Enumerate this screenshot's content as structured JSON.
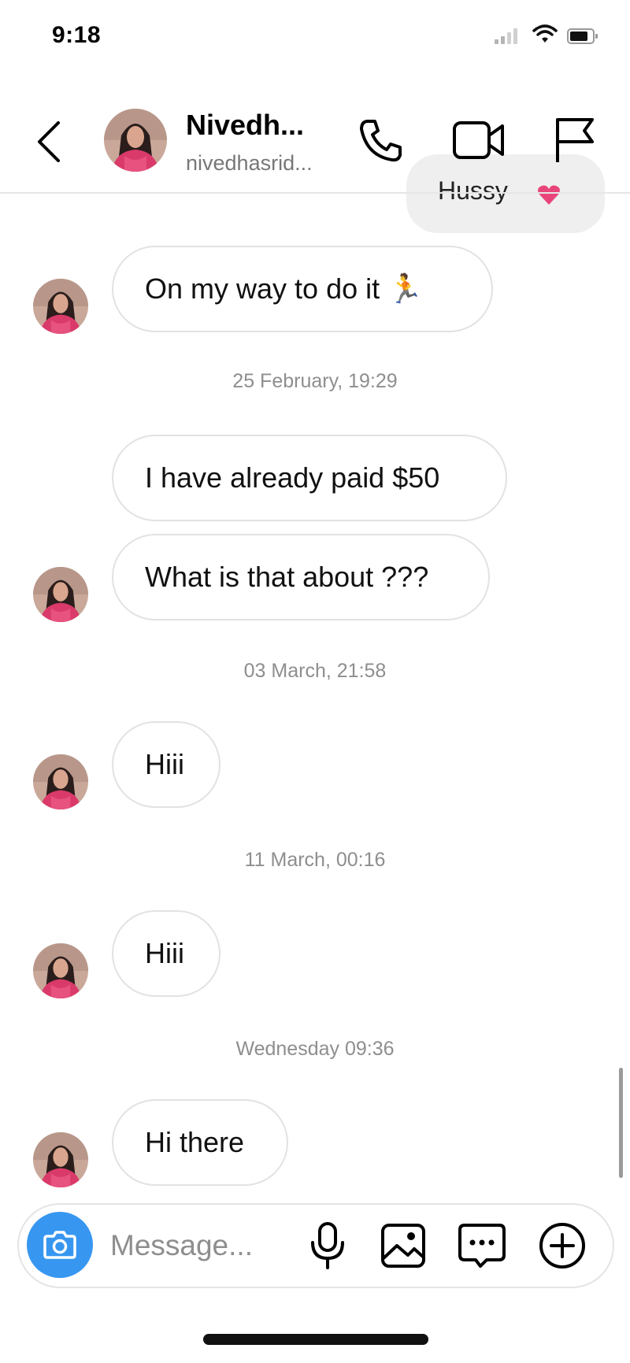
{
  "status_bar": {
    "time": "9:18"
  },
  "header": {
    "name": "Nivedh...",
    "username": "nivedhasrid...",
    "icons": [
      "back-chevron-icon",
      "phone-icon",
      "video-camera-icon",
      "flag-icon"
    ]
  },
  "conversation": {
    "partial_sent_message": {
      "text": "Hussy",
      "emoji": "heart-emoji"
    },
    "msg1": "On my way to do it 🏃",
    "ts1": "25 February, 19:29",
    "msg2": "I have already paid $50",
    "msg3": "What is that about ???",
    "ts2": "03 March, 21:58",
    "msg4": "Hiii",
    "ts3": "11 March, 00:16",
    "msg5": "Hiii",
    "ts4": "Wednesday 09:36",
    "msg6": "Hi there"
  },
  "composer": {
    "placeholder": "Message...",
    "icons": [
      "camera-icon",
      "microphone-icon",
      "gallery-icon",
      "sticker-chat-icon",
      "plus-icon"
    ]
  },
  "colors": {
    "accent": "#3797f0",
    "bubble_border": "#e2e2e2",
    "sent_bubble": "#efefef",
    "timestamp": "#8e8e8e"
  }
}
